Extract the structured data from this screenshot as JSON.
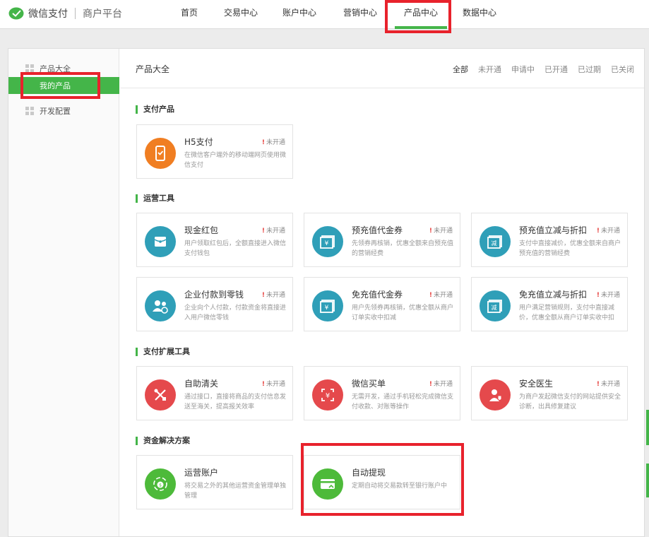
{
  "header": {
    "brand": "微信支付",
    "brand_sub": "商户平台",
    "nav": [
      {
        "label": "首页",
        "active": false
      },
      {
        "label": "交易中心",
        "active": false
      },
      {
        "label": "账户中心",
        "active": false
      },
      {
        "label": "营销中心",
        "active": false
      },
      {
        "label": "产品中心",
        "active": true
      },
      {
        "label": "数据中心",
        "active": false
      }
    ]
  },
  "sidebar": {
    "items": [
      {
        "label": "产品大全"
      },
      {
        "label": "我的产品"
      },
      {
        "label": "开发配置"
      }
    ]
  },
  "content": {
    "title": "产品大全",
    "filters": [
      "全部",
      "未开通",
      "申请中",
      "已开通",
      "已过期",
      "已关闭"
    ]
  },
  "sections": [
    {
      "title": "支付产品",
      "cards": [
        {
          "name": "H5支付",
          "status": "未开通",
          "desc": "在微信客户端外的移动端网页使用微信支付",
          "icon": "phone-icon",
          "color": "#f07e22"
        }
      ]
    },
    {
      "title": "运营工具",
      "cards": [
        {
          "name": "现金红包",
          "status": "未开通",
          "desc": "用户领取红包后，全额直接进入微信支付钱包",
          "icon": "red-packet-icon",
          "color": "#2f9fb8"
        },
        {
          "name": "预充值代金券",
          "status": "未开通",
          "desc": "先领券再核销，优惠全额来自预充值的营销经费",
          "icon": "voucher-icon",
          "color": "#2f9fb8"
        },
        {
          "name": "预充值立减与折扣",
          "status": "未开通",
          "desc": "支付中直接减价，优惠全额来自商户预充值的营销经费",
          "icon": "discount-icon",
          "color": "#2f9fb8"
        },
        {
          "name": "企业付款到零钱",
          "status": "未开通",
          "desc": "企业向个人付款，付款资金将直接进入用户微信零钱",
          "icon": "transfer-icon",
          "color": "#2f9fb8"
        },
        {
          "name": "免充值代金券",
          "status": "未开通",
          "desc": "用户先领券再核销，优惠全额从商户订单实收中扣减",
          "icon": "voucher-icon",
          "color": "#2f9fb8"
        },
        {
          "name": "免充值立减与折扣",
          "status": "未开通",
          "desc": "用户满足营销规则，支付中直接减价，优惠全额从商户订单实收中扣",
          "icon": "discount-icon",
          "color": "#2f9fb8"
        }
      ]
    },
    {
      "title": "支付扩展工具",
      "cards": [
        {
          "name": "自助清关",
          "status": "未开通",
          "desc": "通过接口，直接将商品的支付信息发送至海关，提高报关效率",
          "icon": "customs-icon",
          "color": "#e5494c"
        },
        {
          "name": "微信买单",
          "status": "未开通",
          "desc": "无需开发，通过手机轻松完成微信支付收款、对账等操作",
          "icon": "scan-pay-icon",
          "color": "#e5494c"
        },
        {
          "name": "安全医生",
          "status": "未开通",
          "desc": "为商户发起微信支付的网站提供安全诊断，出具修复建议",
          "icon": "doctor-icon",
          "color": "#e5494c"
        }
      ]
    },
    {
      "title": "资金解决方案",
      "cards": [
        {
          "name": "运营账户",
          "status": "",
          "desc": "将交易之外的其他运营资金管理单独管理",
          "icon": "account-icon",
          "color": "#4dba3a"
        },
        {
          "name": "自动提现",
          "status": "",
          "desc": "定期自动将交易款转至银行账户中",
          "icon": "withdraw-icon",
          "color": "#4dba3a"
        }
      ]
    }
  ]
}
